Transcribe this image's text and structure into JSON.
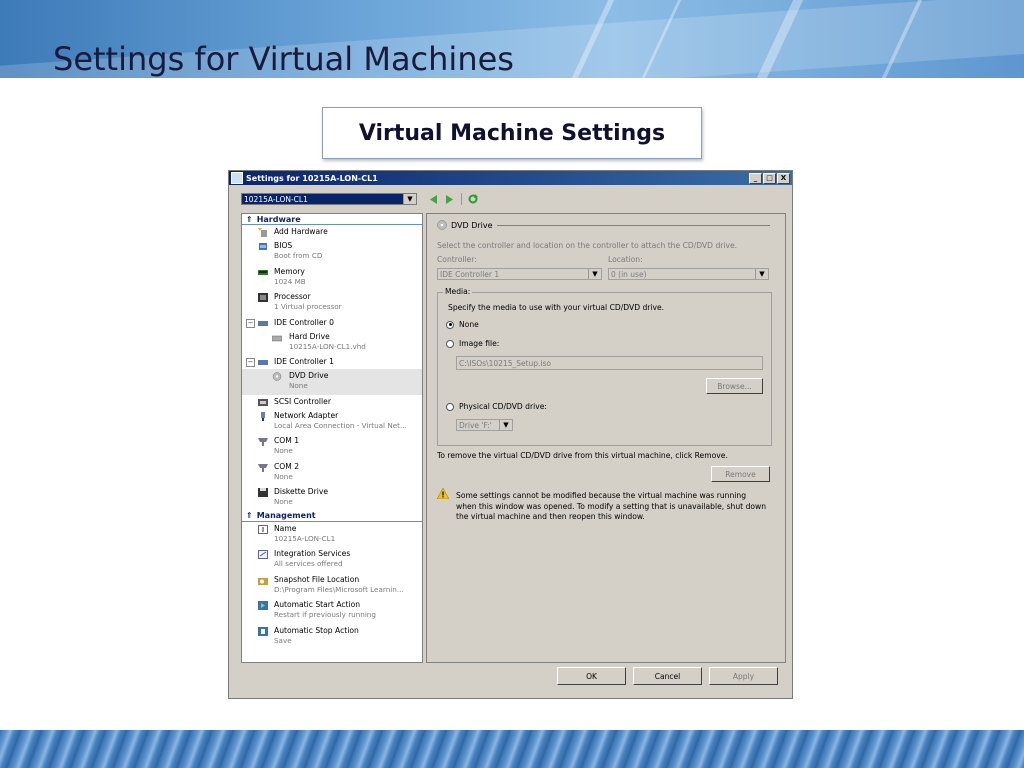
{
  "slide": {
    "title": "Settings for Virtual Machines",
    "callout": "Virtual Machine Settings"
  },
  "window": {
    "title": "Settings for 10215A-LON-CL1",
    "vm_selector": "10215A-LON-CL1",
    "controls": {
      "minimize": "_",
      "maximize": "□",
      "close": "X"
    }
  },
  "tree": {
    "hardware_label": "Hardware",
    "management_label": "Management",
    "hardware": [
      {
        "label": "Add Hardware",
        "sub": ""
      },
      {
        "label": "BIOS",
        "sub": "Boot from CD"
      },
      {
        "label": "Memory",
        "sub": "1024 MB"
      },
      {
        "label": "Processor",
        "sub": "1 Virtual processor"
      },
      {
        "label": "IDE Controller 0",
        "sub": ""
      },
      {
        "label": "Hard Drive",
        "sub": "10215A-LON-CL1.vhd"
      },
      {
        "label": "IDE Controller 1",
        "sub": ""
      },
      {
        "label": "DVD Drive",
        "sub": "None"
      },
      {
        "label": "SCSI Controller",
        "sub": ""
      },
      {
        "label": "Network Adapter",
        "sub": "Local Area Connection - Virtual Net..."
      },
      {
        "label": "COM 1",
        "sub": "None"
      },
      {
        "label": "COM 2",
        "sub": "None"
      },
      {
        "label": "Diskette Drive",
        "sub": "None"
      }
    ],
    "management": [
      {
        "label": "Name",
        "sub": "10215A-LON-CL1"
      },
      {
        "label": "Integration Services",
        "sub": "All services offered"
      },
      {
        "label": "Snapshot File Location",
        "sub": "D:\\Program Files\\Microsoft Learnin..."
      },
      {
        "label": "Automatic Start Action",
        "sub": "Restart if previously running"
      },
      {
        "label": "Automatic Stop Action",
        "sub": "Save"
      }
    ]
  },
  "panel": {
    "group_title": "DVD Drive",
    "instruction": "Select the controller and location on the controller to attach the CD/DVD drive.",
    "controller_label": "Controller:",
    "controller_value": "IDE Controller 1",
    "location_label": "Location:",
    "location_value": "0 (in use)",
    "media_legend": "Media:",
    "media_instruction": "Specify the media to use with your virtual CD/DVD drive.",
    "radio_none": "None",
    "radio_image": "Image file:",
    "image_path": "C:\\ISOs\\10215_Setup.iso",
    "browse": "Browse...",
    "radio_physical": "Physical CD/DVD drive:",
    "physical_value": "Drive 'F:'",
    "remove_text": "To remove the virtual CD/DVD drive from this virtual machine, click Remove.",
    "remove": "Remove",
    "warning": "Some settings cannot be modified because the virtual machine was running when this window was opened. To modify a setting that is unavailable, shut down the virtual machine and then reopen this window."
  },
  "footer": {
    "ok": "OK",
    "cancel": "Cancel",
    "apply": "Apply"
  }
}
